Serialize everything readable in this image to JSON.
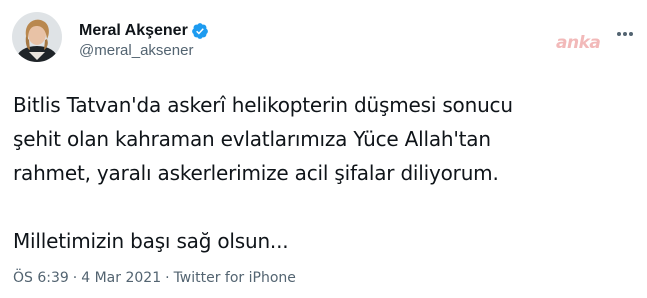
{
  "author": {
    "display_name": "Meral Akşener",
    "handle": "@meral_aksener",
    "verified": true,
    "avatar_icon": "profile-photo"
  },
  "watermark": "anka",
  "tweet": {
    "lines": [
      "Bitlis Tatvan'da askerî helikopterin düşmesi sonucu",
      "şehit olan kahraman evlatlarımıza Yüce Allah'tan",
      "rahmet, yaralı askerlerimize acil şifalar diliyorum.",
      "Milletimizin başı sağ olsun..."
    ]
  },
  "meta": {
    "time": "ÖS 6:39",
    "separator": "·",
    "date": "4 Mar 2021",
    "source": "Twitter for iPhone"
  },
  "colors": {
    "text": "#0f1419",
    "secondary": "#536471",
    "verified": "#1d9bf0",
    "watermark": "#f2b9b9"
  }
}
